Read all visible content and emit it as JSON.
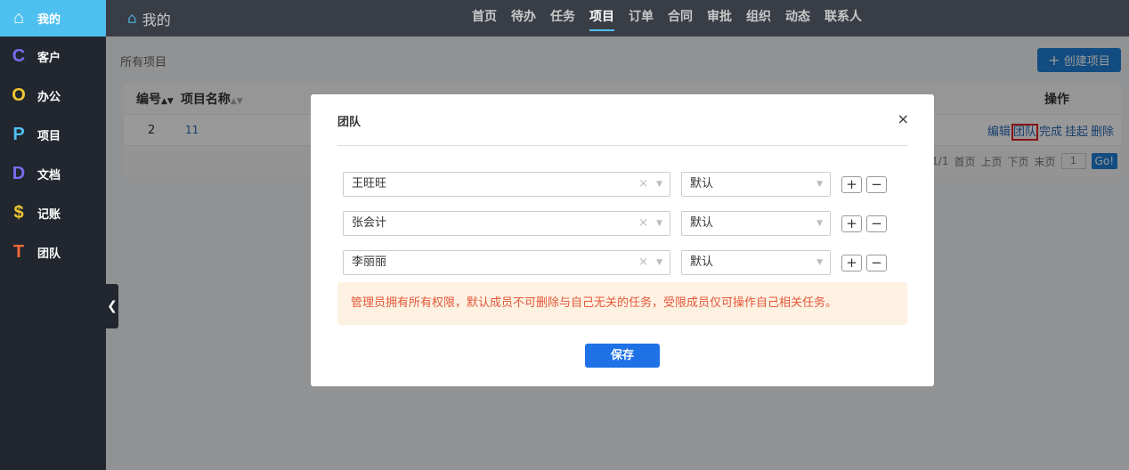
{
  "sidebar": {
    "items": [
      {
        "label": "我的",
        "icon": "⌂",
        "color": "#ffffff"
      },
      {
        "label": "客户",
        "icon": "C",
        "color": "#7a6cf0"
      },
      {
        "label": "办公",
        "icon": "O",
        "color": "#f0c832"
      },
      {
        "label": "项目",
        "icon": "P",
        "color": "#4ec0ef"
      },
      {
        "label": "文档",
        "icon": "D",
        "color": "#7a6cf0"
      },
      {
        "label": "记账",
        "icon": "$",
        "color": "#f0c832"
      },
      {
        "label": "团队",
        "icon": "T",
        "color": "#f0693a"
      }
    ]
  },
  "header": {
    "title": "我的",
    "nav": [
      "首页",
      "待办",
      "任务",
      "项目",
      "订单",
      "合同",
      "审批",
      "组织",
      "动态",
      "联系人"
    ]
  },
  "page": {
    "breadcrumb": "所有项目",
    "create_label": "创建项目"
  },
  "table": {
    "headers": {
      "id": "编号",
      "name": "项目名称",
      "ops": "操作"
    },
    "rows": [
      {
        "id": "2",
        "name": "11",
        "ops": [
          "编辑",
          "团队",
          "完成",
          "挂起",
          "删除"
        ]
      }
    ],
    "pager": {
      "page": "1/1",
      "first": "首页",
      "prev": "上页",
      "next": "下页",
      "last": "末页",
      "input": "1",
      "go": "Go!"
    }
  },
  "modal": {
    "title": "团队",
    "close": "×",
    "members": [
      {
        "name": "王旺旺",
        "role": "默认"
      },
      {
        "name": "张会计",
        "role": "默认"
      },
      {
        "name": "李丽丽",
        "role": "默认"
      }
    ],
    "notice": "管理员拥有所有权限，默认成员不可删除与自己无关的任务，受限成员仅可操作自己相关任务。",
    "save": "保存"
  }
}
